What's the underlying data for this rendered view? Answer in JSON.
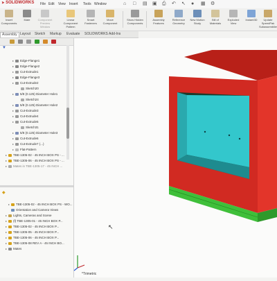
{
  "app": {
    "brand": "SOLIDWORKS"
  },
  "menu": [
    "File",
    "Edit",
    "View",
    "Insert",
    "Tools",
    "Window"
  ],
  "ribbon": [
    {
      "label": "Insert Components",
      "dim": false
    },
    {
      "label": "Mate",
      "dim": false
    },
    {
      "label": "Component Preview Window",
      "dim": true
    },
    {
      "label": "Linear Component Pattern",
      "dim": false
    },
    {
      "label": "Smart Fasteners",
      "dim": false
    },
    {
      "label": "Move Component",
      "dim": false
    },
    {
      "label": "Show Hidden Components",
      "dim": false
    },
    {
      "label": "Assembly Features",
      "dim": false
    },
    {
      "label": "Reference Geometry",
      "dim": false
    },
    {
      "label": "New Motion Study",
      "dim": false
    },
    {
      "label": "Bill of Materials",
      "dim": false
    },
    {
      "label": "Exploded View",
      "dim": false
    },
    {
      "label": "Instant3D",
      "dim": false
    },
    {
      "label": "Update SpeedPak Subassemblies",
      "dim": false
    }
  ],
  "tabs": [
    "Assembly",
    "Layout",
    "Sketch",
    "Markup",
    "Evaluate",
    "SOLIDWORKS Add-Ins"
  ],
  "tree_top": [
    "Edge-Flange1",
    "Edge-Flange2",
    "Cut-Extrude1",
    "Edge-Flange3",
    "Cut-Extrude2",
    "Sketch20",
    "5/8 (0.125) Diameter Hole1",
    "Sketch24",
    "5/8 (0.125) Diameter Hole2",
    "Cut-Extrude3",
    "Cut-Extrude4",
    "Cut-Extrude5",
    "Sketch31",
    "5/8 (0.125) Diameter Hole3",
    "Cut-Extrude6",
    "Cut-Extrude7 (...)",
    "Flat-Pattern",
    "TBE-1305-02 - 45 INCH BOX PS - ...",
    "TBE-1305-06 - 45 INCH BOX PS - ...",
    "Mates in TBE-1305-17 - 45 INCH ..."
  ],
  "tree_bottom": [
    "TBE-1305-02 - 45 INCH BOX PS - WO...",
    "Orientation and Camera Views",
    "Lights, Cameras and Scene",
    "(f) TBE-1305-01 - 45 INCH BOX P...",
    "TBE-1305-02 - 45 INCH BOX P...",
    "TBE-1305-05 - 45 INCH BOX P...",
    "TBE-1305-06 - 45 INCH BOX P...",
    "TBE-1305-08 REV A - 45 INCH BO...",
    "Mates"
  ],
  "viewport": {
    "view_label": "*Trimetric"
  },
  "colors": {
    "red": "#d42a22",
    "cyan": "#33c7cc",
    "green": "#3fbf3a",
    "brand": "#c0282c"
  }
}
